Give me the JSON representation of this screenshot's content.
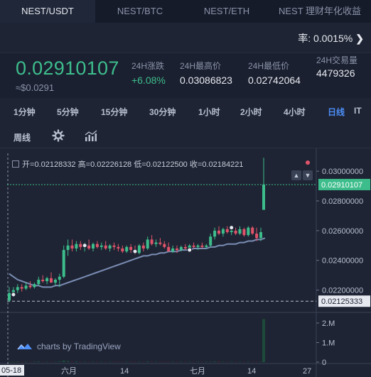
{
  "tabs": [
    {
      "label": "NEST/USDT",
      "active": true
    },
    {
      "label": "NEST/BTC",
      "active": false
    },
    {
      "label": "NEST/ETH",
      "active": false
    },
    {
      "label": "NEST 理财年化收益",
      "active": false
    }
  ],
  "rate": {
    "label": "率: 0.0015%",
    "arrow": "❯"
  },
  "ticker": {
    "price": "0.02910107",
    "usd": "≈$0.0291",
    "change_label": "24H涨跌",
    "change_value": "+6.08%",
    "high_label": "24H最高价",
    "high_value": "0.03086823",
    "low_label": "24H最低价",
    "low_value": "0.02742064",
    "volume_label": "24H交易量",
    "volume_value": "4479326"
  },
  "timeframes": [
    {
      "label": "1分钟",
      "active": false
    },
    {
      "label": "5分钟",
      "active": false
    },
    {
      "label": "15分钟",
      "active": false
    },
    {
      "label": "30分钟",
      "active": false
    },
    {
      "label": "1小时",
      "active": false
    },
    {
      "label": "2小时",
      "active": false
    },
    {
      "label": "4小时",
      "active": false
    },
    {
      "label": "日线",
      "active": true
    },
    {
      "label": "IT",
      "active": false
    }
  ],
  "timeframe_row2": {
    "weekly": "周线",
    "settings_icon": "gear-icon",
    "indicator_icon": "chart-indicator-icon"
  },
  "ohlc": {
    "open_label": "开=",
    "open": "0.02128332",
    "high_label": "高=",
    "high": "0.02226128",
    "low_label": "低=",
    "low": "0.02122500",
    "close_label": "收=",
    "close": "0.02184221"
  },
  "colors": {
    "up": "#3dbd8c",
    "down": "#e0546b",
    "ma": "#7b8db5",
    "price_tag": "#3dbd8c",
    "accent": "#4d8ef7"
  },
  "branding": {
    "text": "charts by TradingView"
  },
  "chart_data": {
    "type": "candlestick",
    "y_axis_labels": [
      "0.03000000",
      "0.02800000",
      "0.02600000",
      "0.02400000",
      "0.02200000"
    ],
    "y_axis_values": [
      0.03,
      0.028,
      0.026,
      0.024,
      0.022
    ],
    "ylim": [
      0.0205,
      0.0312
    ],
    "current_price_tag": "0.02910107",
    "current_price": 0.02910107,
    "low_line_tag": "0.02125333",
    "low_line": 0.02125333,
    "x_axis_labels": [
      "05-18",
      "六月",
      "14",
      "七月",
      "14",
      "27"
    ],
    "volume_axis_labels": [
      "2.M",
      "1.M",
      "0"
    ],
    "candles": [
      {
        "o": 0.0213,
        "h": 0.0222,
        "l": 0.0212,
        "c": 0.0218
      },
      {
        "o": 0.0218,
        "h": 0.0222,
        "l": 0.0216,
        "c": 0.022
      },
      {
        "o": 0.022,
        "h": 0.0224,
        "l": 0.0218,
        "c": 0.0222
      },
      {
        "o": 0.0222,
        "h": 0.0224,
        "l": 0.0219,
        "c": 0.0221
      },
      {
        "o": 0.0221,
        "h": 0.0225,
        "l": 0.022,
        "c": 0.0223
      },
      {
        "o": 0.0223,
        "h": 0.0226,
        "l": 0.0221,
        "c": 0.0222
      },
      {
        "o": 0.0222,
        "h": 0.0225,
        "l": 0.0221,
        "c": 0.0224
      },
      {
        "o": 0.0224,
        "h": 0.0229,
        "l": 0.0223,
        "c": 0.0227
      },
      {
        "o": 0.0227,
        "h": 0.023,
        "l": 0.0225,
        "c": 0.0226
      },
      {
        "o": 0.0226,
        "h": 0.0229,
        "l": 0.0224,
        "c": 0.0228
      },
      {
        "o": 0.0228,
        "h": 0.0232,
        "l": 0.0226,
        "c": 0.0225
      },
      {
        "o": 0.0225,
        "h": 0.0228,
        "l": 0.0223,
        "c": 0.0227
      },
      {
        "o": 0.0227,
        "h": 0.0231,
        "l": 0.0222,
        "c": 0.0229
      },
      {
        "o": 0.0229,
        "h": 0.025,
        "l": 0.0228,
        "c": 0.0247
      },
      {
        "o": 0.0247,
        "h": 0.0254,
        "l": 0.0243,
        "c": 0.025
      },
      {
        "o": 0.025,
        "h": 0.0254,
        "l": 0.0246,
        "c": 0.0248
      },
      {
        "o": 0.0248,
        "h": 0.0253,
        "l": 0.0246,
        "c": 0.0251
      },
      {
        "o": 0.0251,
        "h": 0.0253,
        "l": 0.0247,
        "c": 0.0249
      },
      {
        "o": 0.0249,
        "h": 0.0252,
        "l": 0.0246,
        "c": 0.025
      },
      {
        "o": 0.025,
        "h": 0.0254,
        "l": 0.0247,
        "c": 0.0248
      },
      {
        "o": 0.0248,
        "h": 0.0252,
        "l": 0.0246,
        "c": 0.0251
      },
      {
        "o": 0.0251,
        "h": 0.0253,
        "l": 0.0248,
        "c": 0.0249
      },
      {
        "o": 0.0249,
        "h": 0.0252,
        "l": 0.0247,
        "c": 0.025
      },
      {
        "o": 0.025,
        "h": 0.0253,
        "l": 0.0247,
        "c": 0.0248
      },
      {
        "o": 0.0248,
        "h": 0.0251,
        "l": 0.0246,
        "c": 0.025
      },
      {
        "o": 0.025,
        "h": 0.0252,
        "l": 0.0247,
        "c": 0.0249
      },
      {
        "o": 0.0249,
        "h": 0.0251,
        "l": 0.0246,
        "c": 0.0248
      },
      {
        "o": 0.0248,
        "h": 0.025,
        "l": 0.0245,
        "c": 0.0246
      },
      {
        "o": 0.0246,
        "h": 0.025,
        "l": 0.0245,
        "c": 0.0249
      },
      {
        "o": 0.0249,
        "h": 0.0251,
        "l": 0.0245,
        "c": 0.0247
      },
      {
        "o": 0.0247,
        "h": 0.025,
        "l": 0.0244,
        "c": 0.0245
      },
      {
        "o": 0.0245,
        "h": 0.0251,
        "l": 0.0244,
        "c": 0.025
      },
      {
        "o": 0.025,
        "h": 0.0252,
        "l": 0.0246,
        "c": 0.0248
      },
      {
        "o": 0.0248,
        "h": 0.0256,
        "l": 0.0247,
        "c": 0.0254
      },
      {
        "o": 0.0254,
        "h": 0.0257,
        "l": 0.025,
        "c": 0.0251
      },
      {
        "o": 0.0251,
        "h": 0.0254,
        "l": 0.0249,
        "c": 0.0252
      },
      {
        "o": 0.0252,
        "h": 0.0255,
        "l": 0.025,
        "c": 0.0251
      },
      {
        "o": 0.0251,
        "h": 0.0253,
        "l": 0.0248,
        "c": 0.0249
      },
      {
        "o": 0.0249,
        "h": 0.0252,
        "l": 0.0247,
        "c": 0.0246
      },
      {
        "o": 0.0246,
        "h": 0.025,
        "l": 0.0245,
        "c": 0.0248
      },
      {
        "o": 0.0248,
        "h": 0.025,
        "l": 0.0245,
        "c": 0.0247
      },
      {
        "o": 0.0247,
        "h": 0.025,
        "l": 0.0246,
        "c": 0.0249
      },
      {
        "o": 0.0249,
        "h": 0.0251,
        "l": 0.0247,
        "c": 0.0248
      },
      {
        "o": 0.0248,
        "h": 0.0251,
        "l": 0.0247,
        "c": 0.025
      },
      {
        "o": 0.025,
        "h": 0.0252,
        "l": 0.0248,
        "c": 0.0249
      },
      {
        "o": 0.0249,
        "h": 0.0251,
        "l": 0.0247,
        "c": 0.025
      },
      {
        "o": 0.025,
        "h": 0.0252,
        "l": 0.0248,
        "c": 0.0249
      },
      {
        "o": 0.0249,
        "h": 0.0251,
        "l": 0.0248,
        "c": 0.025
      },
      {
        "o": 0.025,
        "h": 0.0258,
        "l": 0.0249,
        "c": 0.0256
      },
      {
        "o": 0.0256,
        "h": 0.0262,
        "l": 0.0254,
        "c": 0.026
      },
      {
        "o": 0.026,
        "h": 0.0263,
        "l": 0.0257,
        "c": 0.0258
      },
      {
        "o": 0.0258,
        "h": 0.0262,
        "l": 0.0256,
        "c": 0.0261
      },
      {
        "o": 0.0261,
        "h": 0.0263,
        "l": 0.0258,
        "c": 0.0259
      },
      {
        "o": 0.0259,
        "h": 0.0262,
        "l": 0.0257,
        "c": 0.026
      },
      {
        "o": 0.026,
        "h": 0.0262,
        "l": 0.0257,
        "c": 0.0258
      },
      {
        "o": 0.0258,
        "h": 0.0263,
        "l": 0.0257,
        "c": 0.0261
      },
      {
        "o": 0.0261,
        "h": 0.0262,
        "l": 0.0256,
        "c": 0.0257
      },
      {
        "o": 0.0257,
        "h": 0.0263,
        "l": 0.0256,
        "c": 0.0262
      },
      {
        "o": 0.0262,
        "h": 0.0263,
        "l": 0.0257,
        "c": 0.0258
      },
      {
        "o": 0.0258,
        "h": 0.0262,
        "l": 0.0253,
        "c": 0.0255
      },
      {
        "o": 0.0255,
        "h": 0.0262,
        "l": 0.0253,
        "c": 0.0259
      },
      {
        "o": 0.0274,
        "h": 0.0309,
        "l": 0.0274,
        "c": 0.0291
      }
    ],
    "ma_points": [
      0.0231,
      0.0229,
      0.0227,
      0.0226,
      0.0225,
      0.0224,
      0.0223,
      0.0223,
      0.0222,
      0.0222,
      0.0222,
      0.0223,
      0.0223,
      0.0224,
      0.0225,
      0.0226,
      0.0227,
      0.0228,
      0.0229,
      0.023,
      0.0231,
      0.0232,
      0.0233,
      0.0234,
      0.0235,
      0.0236,
      0.0237,
      0.0238,
      0.0239,
      0.024,
      0.0241,
      0.0242,
      0.0243,
      0.0243,
      0.0244,
      0.0244,
      0.0245,
      0.0245,
      0.0246,
      0.0246,
      0.0246,
      0.0247,
      0.0247,
      0.0247,
      0.0248,
      0.0248,
      0.0248,
      0.0248,
      0.0249,
      0.0249,
      0.025,
      0.025,
      0.0251,
      0.0251,
      0.0251,
      0.0252,
      0.0252,
      0.0253,
      0.0253,
      0.0254,
      0.0254,
      0.0255
    ],
    "volumes": [
      0.02,
      0.01,
      0.02,
      0.01,
      0.02,
      0.01,
      0.02,
      0.03,
      0.02,
      0.02,
      0.02,
      0.01,
      0.03,
      0.08,
      0.05,
      0.03,
      0.03,
      0.02,
      0.02,
      0.02,
      0.02,
      0.02,
      0.02,
      0.02,
      0.02,
      0.02,
      0.02,
      0.02,
      0.02,
      0.02,
      0.02,
      0.02,
      0.02,
      0.03,
      0.02,
      0.02,
      0.02,
      0.02,
      0.02,
      0.02,
      0.02,
      0.02,
      0.02,
      0.02,
      0.02,
      0.02,
      0.02,
      0.02,
      0.02,
      0.03,
      0.04,
      0.02,
      0.02,
      0.02,
      0.02,
      0.02,
      0.02,
      0.02,
      0.02,
      0.02,
      0.02,
      2.2
    ],
    "markers": [
      {
        "i": 1,
        "price": 0.0217
      },
      {
        "i": 18,
        "price": 0.025
      },
      {
        "i": 30,
        "price": 0.0246
      },
      {
        "i": 43,
        "price": 0.0247
      },
      {
        "i": 53,
        "price": 0.0262
      }
    ]
  }
}
